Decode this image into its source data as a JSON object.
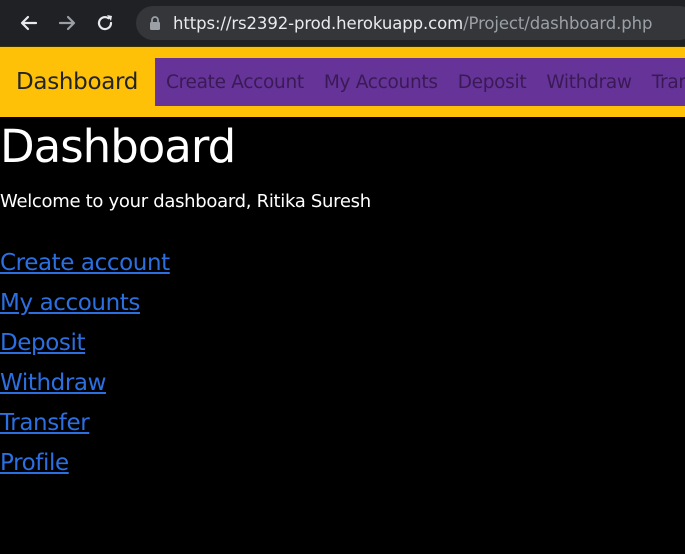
{
  "browser": {
    "url_host": "https://rs2392-prod.herokuapp.com",
    "url_path": "/Project/dashboard.php"
  },
  "navbar": {
    "brand": "Dashboard",
    "links": [
      "Create Account",
      "My Accounts",
      "Deposit",
      "Withdraw",
      "Transfer"
    ]
  },
  "main": {
    "title": "Dashboard",
    "welcome": "Welcome to your dashboard, Ritika Suresh",
    "links": [
      "Create account",
      "My accounts",
      "Deposit",
      "Withdraw",
      "Transfer",
      "Profile"
    ]
  },
  "colors": {
    "navbar_bg": "#ffc107",
    "nav_links_bg": "#663399",
    "page_bg": "#000000",
    "link": "#2b6fe0"
  },
  "icons": {
    "back": "back-arrow-icon",
    "forward": "forward-arrow-icon",
    "reload": "reload-icon",
    "lock": "lock-icon"
  }
}
